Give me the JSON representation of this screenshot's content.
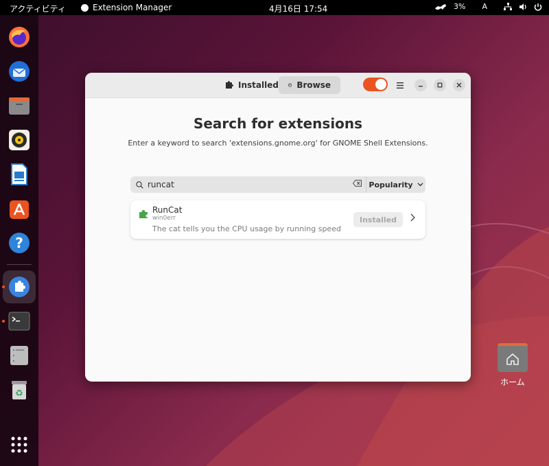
{
  "topbar": {
    "activities": "アクティビティ",
    "app_name": "Extension Manager",
    "clock": "4月16日  17:54",
    "battery": "3%",
    "input_method": "A"
  },
  "dock": {
    "items": [
      {
        "name": "firefox",
        "icon": "firefox-icon"
      },
      {
        "name": "thunderbird",
        "icon": "thunderbird-icon"
      },
      {
        "name": "files",
        "icon": "files-icon"
      },
      {
        "name": "rhythmbox",
        "icon": "rhythmbox-icon"
      },
      {
        "name": "writer",
        "icon": "libreoffice-writer-icon"
      },
      {
        "name": "software",
        "icon": "app-center-icon"
      },
      {
        "name": "help",
        "icon": "help-icon"
      },
      {
        "name": "extension-manager",
        "icon": "puzzle-icon",
        "running": true,
        "active": true
      },
      {
        "name": "terminal",
        "icon": "terminal-icon",
        "running": true
      },
      {
        "name": "disks",
        "icon": "disks-icon"
      },
      {
        "name": "trash",
        "icon": "trash-icon"
      },
      {
        "name": "show-apps",
        "icon": "app-grid-icon"
      }
    ]
  },
  "desktop": {
    "home_label": "ホーム"
  },
  "window": {
    "tabs": [
      {
        "label": "Installed",
        "icon": "puzzle-icon",
        "active": false
      },
      {
        "label": "Browse",
        "icon": "globe-icon",
        "active": true
      }
    ],
    "title": "Search for extensions",
    "subtitle": "Enter a keyword to search 'extensions.gnome.org' for GNOME Shell Extensions.",
    "search": {
      "value": "runcat",
      "placeholder": ""
    },
    "sort": {
      "selected": "Popularity"
    },
    "results": [
      {
        "name": "RunCat",
        "author": "win0err",
        "description": "The cat tells you the CPU usage by running speed",
        "button_label": "Installed"
      }
    ]
  },
  "colors": {
    "accent": "#e95420",
    "window_bg": "#fafafa",
    "header_bg": "#ebebeb"
  }
}
